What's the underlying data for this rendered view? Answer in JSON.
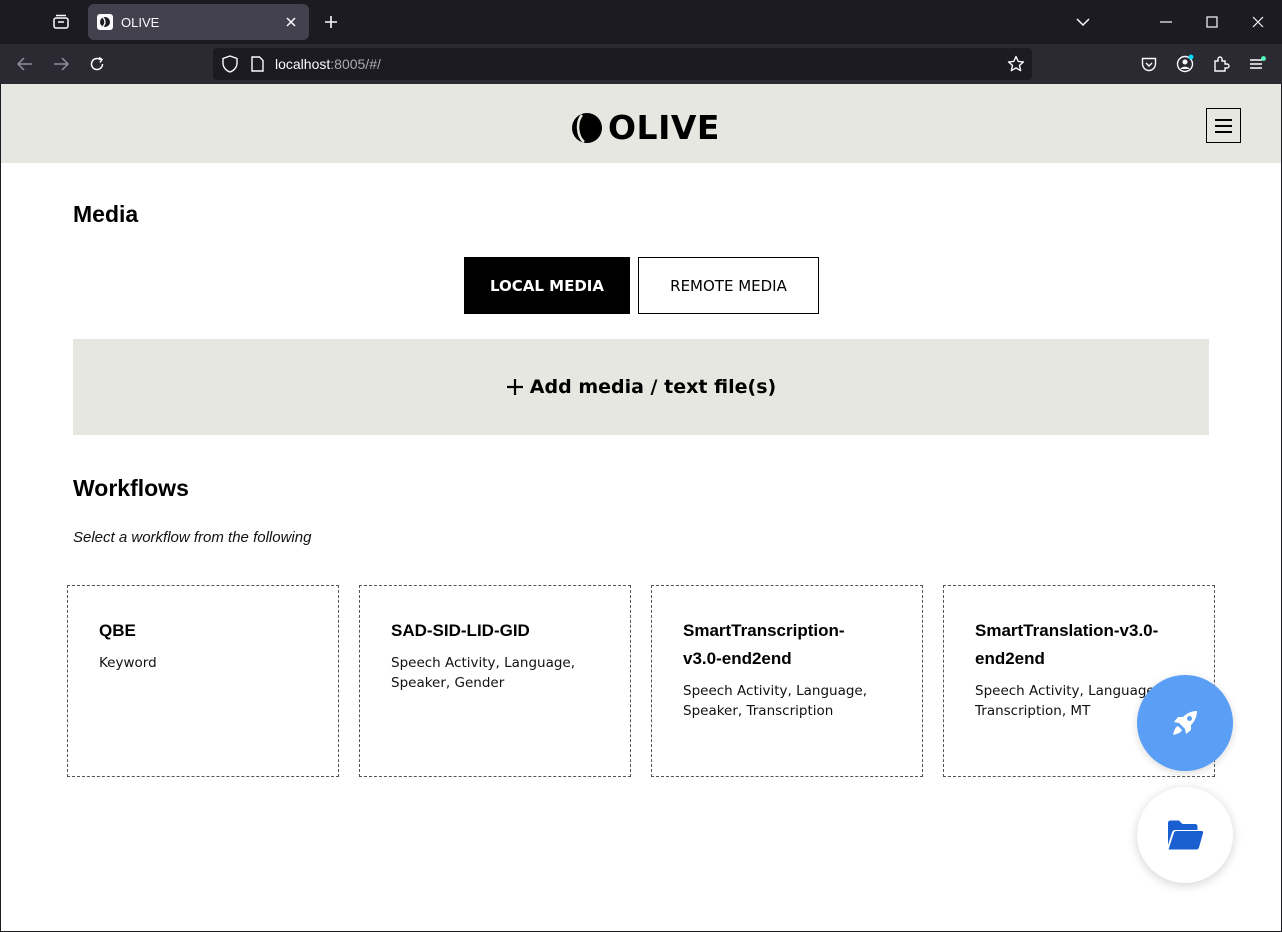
{
  "browser": {
    "tab": {
      "title": "OLIVE"
    },
    "url": {
      "host": "localhost",
      "rest": ":8005/#/"
    }
  },
  "app": {
    "brand": "OLIVE",
    "media": {
      "title": "Media",
      "local_label": "LOCAL MEDIA",
      "remote_label": "REMOTE MEDIA",
      "add_label": "Add media / text file(s)"
    },
    "workflows": {
      "title": "Workflows",
      "subtitle": "Select a workflow from the following",
      "cards": [
        {
          "title": "QBE",
          "desc": "Keyword"
        },
        {
          "title": "SAD-SID-LID-GID",
          "desc": "Speech Activity, Language, Speaker, Gender"
        },
        {
          "title": "SmartTranscription-v3.0-end2end",
          "desc": "Speech Activity, Language, Speaker, Transcription"
        },
        {
          "title": "SmartTranslation-v3.0-end2end",
          "desc": "Speech Activity, Language, Transcription, MT"
        }
      ]
    }
  },
  "colors": {
    "accent_fab": "#5a9ef5",
    "header_bg": "#e7e7e2",
    "folder_icon": "#1a5fd0"
  },
  "icons": {
    "fab_launch": "rocket-icon",
    "fab_files": "folder-open-icon"
  }
}
